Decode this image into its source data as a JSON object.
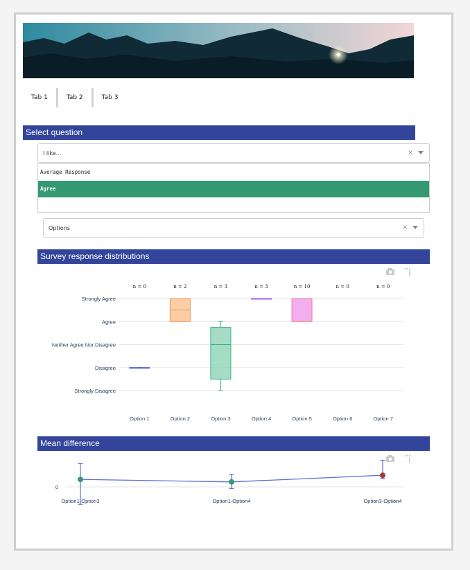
{
  "tabs": [
    {
      "label": "Tab 1"
    },
    {
      "label": "Tab 2"
    },
    {
      "label": "Tab 3"
    }
  ],
  "sections": {
    "select_question": "Select question",
    "survey_distributions": "Survey response distributions",
    "mean_difference": "Mean difference"
  },
  "question_dropdown": {
    "value": "I like...",
    "clear": "×"
  },
  "question_menu": {
    "items": [
      {
        "label": "Average Response",
        "selected": false
      },
      {
        "label": "Agree",
        "selected": true
      }
    ]
  },
  "options_dropdown": {
    "value": "Options",
    "clear": "×"
  },
  "colors": {
    "section_bar": "#32459a",
    "selected_item": "#339a73"
  },
  "chart_data": [
    {
      "type": "box",
      "categories": [
        "Option 1",
        "Option 2",
        "Option 3",
        "Option 4",
        "Option 5",
        "Option 6",
        "Option 7"
      ],
      "y_categories": [
        "Strongly Disagree",
        "Disagree",
        "Neither Agree Nor Disagree",
        "Agree",
        "Strongly Agree"
      ],
      "n_labels": [
        "n = 0",
        "n = 2",
        "n = 3",
        "n = 3",
        "n = 10",
        "n = 0",
        "n = 0"
      ],
      "boxes": [
        {
          "category": "Option 1",
          "min": 2,
          "q1": 2,
          "median": 2,
          "q3": 2,
          "max": 2,
          "color": "#5566dd",
          "fill": "#5566dd"
        },
        {
          "category": "Option 2",
          "min": 4,
          "q1": 4,
          "median": 4.5,
          "q3": 5,
          "max": 5,
          "color": "#ef9463",
          "fill": "#fdc18f"
        },
        {
          "category": "Option 3",
          "min": 1,
          "q1": 1.5,
          "median": 3,
          "q3": 3.75,
          "max": 4,
          "color": "#2fb58a",
          "fill": "#8fd3b7"
        },
        {
          "category": "Option 4",
          "min": 5,
          "q1": 5,
          "median": 5,
          "q3": 5,
          "max": 5,
          "color": "#9a5de8",
          "fill": "#9a5de8"
        },
        {
          "category": "Option 5",
          "min": 4,
          "q1": 4,
          "median": 5,
          "q3": 5,
          "max": 5,
          "color": "#ee7f86",
          "fill": "#f099ee"
        }
      ]
    },
    {
      "type": "scatter",
      "categories": [
        "Option1-Option3",
        "Option1-Option4",
        "Option3-Option4"
      ],
      "y_ticks": [
        "0"
      ],
      "points": [
        {
          "x": "Option1-Option3",
          "y": 0.45,
          "err_low": 1.5,
          "err_high": 0.95,
          "color": "#339a73"
        },
        {
          "x": "Option1-Option4",
          "y": 0.3,
          "err_low": 0.4,
          "err_high": 0.45,
          "color": "#339a73"
        },
        {
          "x": "Option3-Option4",
          "y": 0.7,
          "err_low": 0.2,
          "err_high": 0.9,
          "color": "#a33a3f"
        }
      ],
      "line_color": "#5b6edb"
    }
  ]
}
